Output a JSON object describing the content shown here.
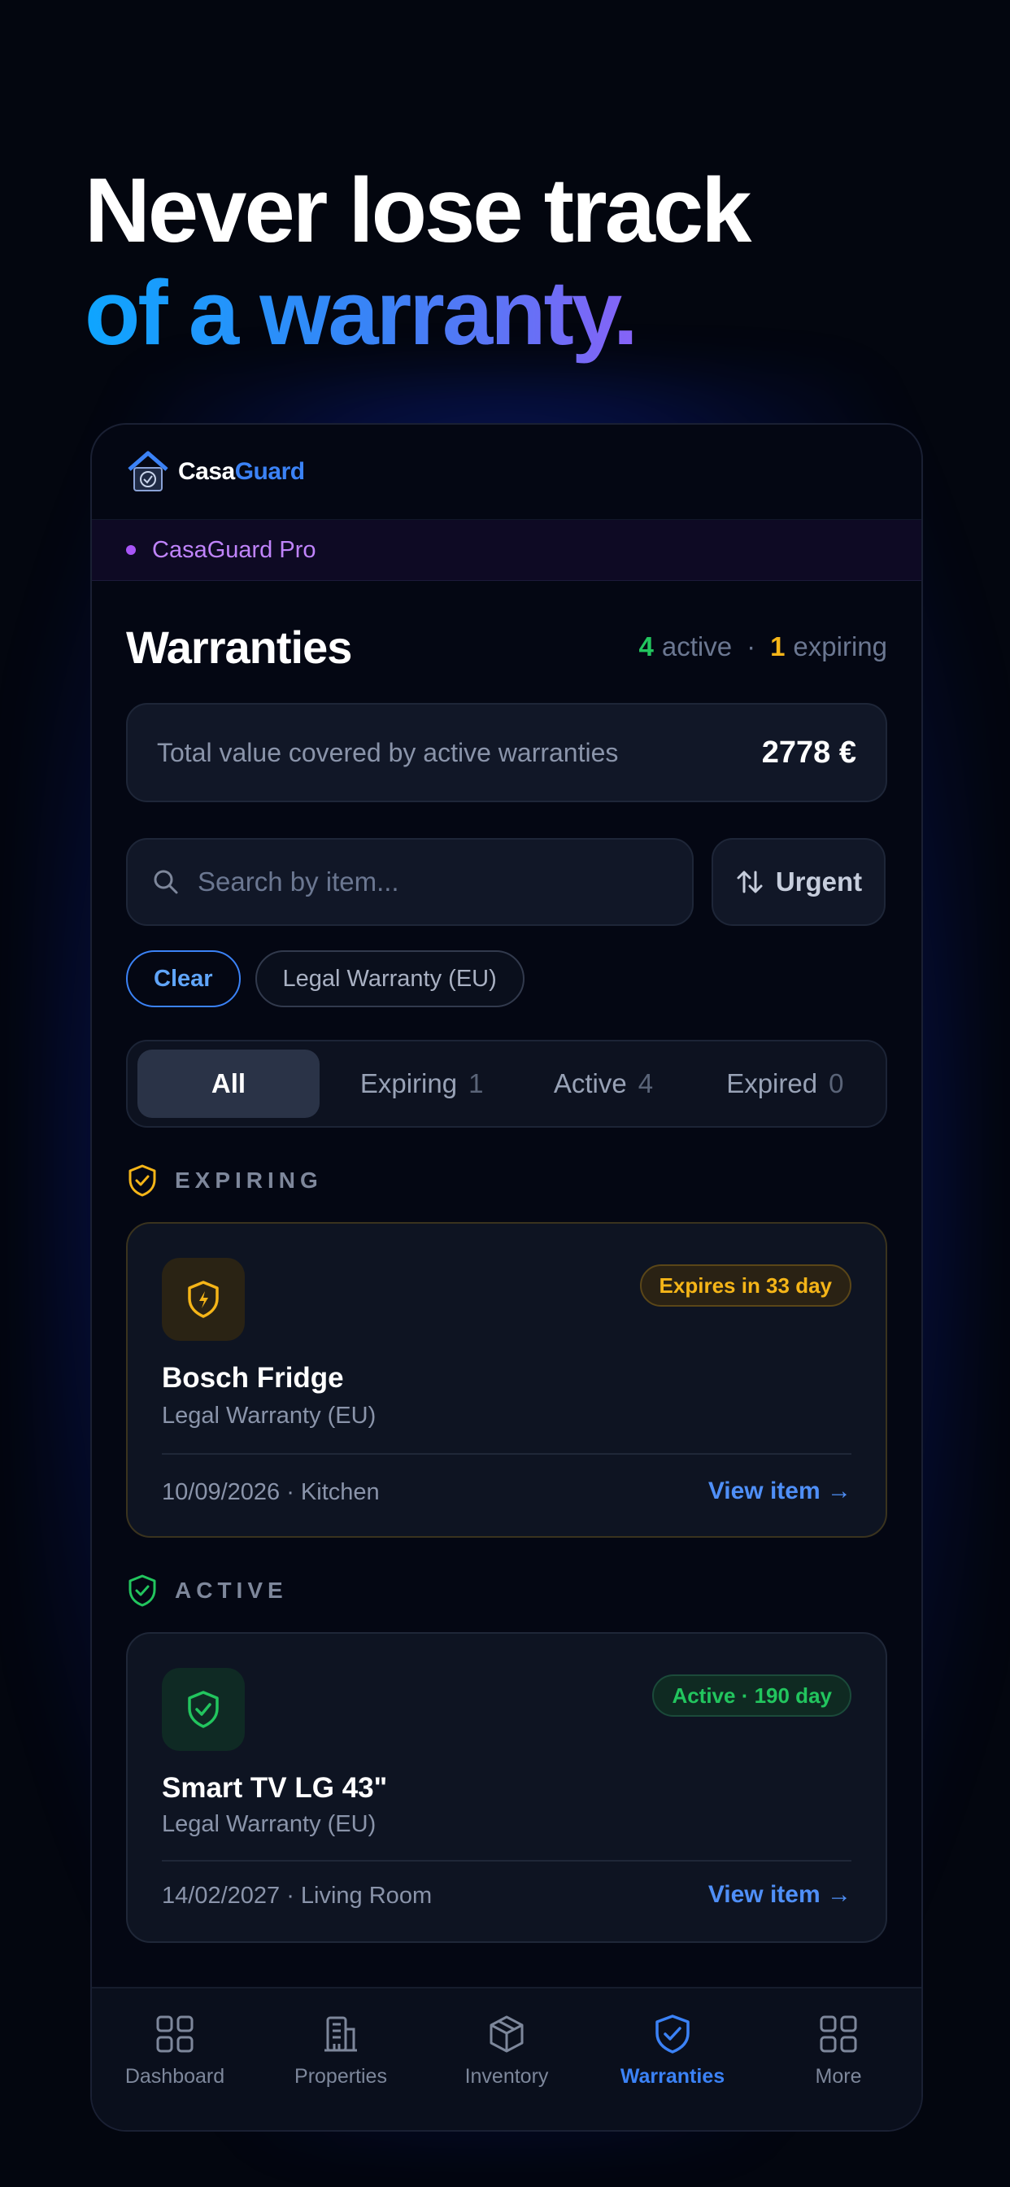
{
  "headline": {
    "line1": "Never lose track",
    "line2": "of a warranty."
  },
  "app": {
    "logo_part1": "Casa",
    "logo_part2": "Guard",
    "plan": "CasaGuard Pro"
  },
  "page": {
    "title": "Warranties",
    "active_count": "4",
    "active_label": "active",
    "separator": "·",
    "expiring_count": "1",
    "expiring_label": "expiring"
  },
  "total": {
    "label": "Total value covered by active warranties",
    "value": "2778 €"
  },
  "search": {
    "placeholder": "Search by item..."
  },
  "sort": {
    "label": "Urgent"
  },
  "filters": {
    "clear": "Clear",
    "active_filter": "Legal Warranty (EU)"
  },
  "tabs": [
    {
      "label": "All",
      "count": ""
    },
    {
      "label": "Expiring",
      "count": "1"
    },
    {
      "label": "Active",
      "count": "4"
    },
    {
      "label": "Expired",
      "count": "0"
    }
  ],
  "sections": {
    "expiring": "EXPIRING",
    "active": "ACTIVE"
  },
  "cards": [
    {
      "badge": "Expires in 33 day",
      "name": "Bosch Fridge",
      "type": "Legal Warranty (EU)",
      "meta": "10/09/2026 · Kitchen",
      "link": "View item →",
      "status_color": "#f5b518"
    },
    {
      "badge": "Active · 190 day",
      "name": "Smart TV LG 43\"",
      "type": "Legal Warranty (EU)",
      "meta": "14/02/2027 · Living Room",
      "link": "View item →",
      "status_color": "#22c55e"
    }
  ],
  "nav": [
    {
      "label": "Dashboard",
      "icon": "grid-icon"
    },
    {
      "label": "Properties",
      "icon": "building-icon"
    },
    {
      "label": "Inventory",
      "icon": "box-icon"
    },
    {
      "label": "Warranties",
      "icon": "shield-check-icon",
      "active": true
    },
    {
      "label": "More",
      "icon": "grid-icon"
    }
  ],
  "colors": {
    "accent": "#3b82f6",
    "warning": "#f5b518",
    "success": "#22c55e",
    "pro": "#a855f7"
  }
}
